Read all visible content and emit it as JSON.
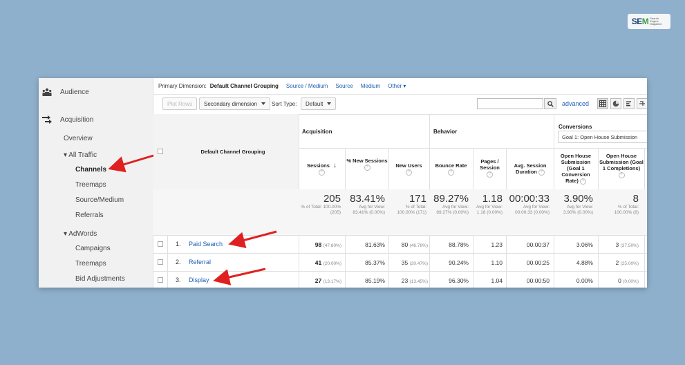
{
  "logo": {
    "brand_s": "SE",
    "brand_m": "M",
    "tagline": "Search Engine Magazine"
  },
  "sidebar": {
    "audience": "Audience",
    "acquisition": "Acquisition",
    "overview": "Overview",
    "all_traffic": "▾ All Traffic",
    "channels": "Channels",
    "treemaps": "Treemaps",
    "source_medium": "Source/Medium",
    "referrals": "Referrals",
    "adwords": "▾ AdWords",
    "campaigns": "Campaigns",
    "treemaps2": "Treemaps",
    "bid_adjustments": "Bid Adjustments"
  },
  "dimension_bar": {
    "label": "Primary Dimension:",
    "current": "Default Channel Grouping",
    "links": [
      "Source / Medium",
      "Source",
      "Medium"
    ],
    "other": "Other ▾"
  },
  "toolbar": {
    "plot_rows": "Plot Rows",
    "secondary_dimension": "Secondary dimension",
    "sort_type_label": "Sort Type:",
    "sort_type_value": "Default",
    "search_placeholder": "",
    "advanced": "advanced"
  },
  "table": {
    "dim_header": "Default Channel Grouping",
    "groups": {
      "acquisition": "Acquisition",
      "behavior": "Behavior",
      "conversions": "Conversions"
    },
    "goal_select": "Goal 1: Open House Submission",
    "columns": {
      "sessions": "Sessions",
      "new_sessions": "% New Sessions",
      "new_users": "New Users",
      "bounce_rate": "Bounce Rate",
      "pages_session": "Pages / Session",
      "avg_duration": "Avg. Session Duration",
      "conv_rate": "Open House Submission (Goal 1 Conversion Rate)",
      "completions": "Open House Submission (Goal 1 Completions)"
    },
    "totals": {
      "sessions": "205",
      "sessions_sub": "% of Total: 100.00% (205)",
      "new_sessions": "83.41%",
      "new_sessions_sub": "Avg for View: 83.41% (0.00%)",
      "new_users": "171",
      "new_users_sub": "% of Total: 100.00% (171)",
      "bounce_rate": "89.27%",
      "bounce_rate_sub": "Avg for View: 89.27% (0.00%)",
      "pages_session": "1.18",
      "pages_session_sub": "Avg for View: 1.18 (0.00%)",
      "avg_duration": "00:00:33",
      "avg_duration_sub": "Avg for View: 00:00:33 (0.00%)",
      "conv_rate": "3.90%",
      "conv_rate_sub": "Avg for View: 3.90% (0.00%)",
      "completions": "8",
      "completions_sub": "% of Total: 100.00% (8)"
    },
    "rows": [
      {
        "idx": "1.",
        "name": "Paid Search",
        "sessions": "98",
        "sessions_pct": "(47.80%)",
        "new_sessions": "81.63%",
        "new_users": "80",
        "new_users_pct": "(46.78%)",
        "bounce_rate": "88.78%",
        "pages_session": "1.23",
        "avg_duration": "00:00:37",
        "conv_rate": "3.06%",
        "completions": "3",
        "completions_pct": "(37.50%)"
      },
      {
        "idx": "2.",
        "name": "Referral",
        "sessions": "41",
        "sessions_pct": "(20.00%)",
        "new_sessions": "85.37%",
        "new_users": "35",
        "new_users_pct": "(20.47%)",
        "bounce_rate": "90.24%",
        "pages_session": "1.10",
        "avg_duration": "00:00:25",
        "conv_rate": "4.88%",
        "completions": "2",
        "completions_pct": "(25.00%)"
      },
      {
        "idx": "3.",
        "name": "Display",
        "sessions": "27",
        "sessions_pct": "(13.17%)",
        "new_sessions": "85.19%",
        "new_users": "23",
        "new_users_pct": "(13.45%)",
        "bounce_rate": "96.30%",
        "pages_session": "1.04",
        "avg_duration": "00:00:50",
        "conv_rate": "0.00%",
        "completions": "0",
        "completions_pct": "(0.00%)"
      }
    ]
  },
  "colors": {
    "link": "#1a5fb4",
    "arrow": "#e02020",
    "background": "#8fb0cc"
  }
}
